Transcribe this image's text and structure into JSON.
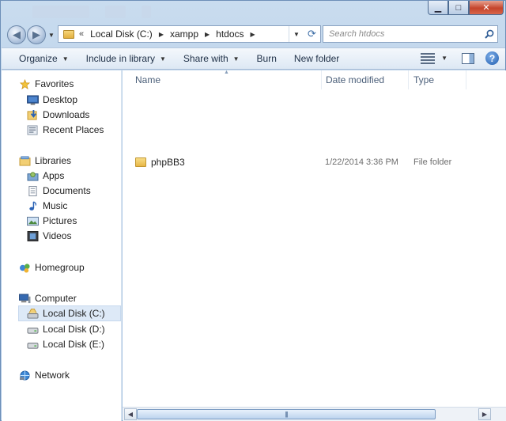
{
  "window": {
    "minimize": "▁",
    "maximize": "□",
    "close": "✕"
  },
  "address": {
    "overflow": "«",
    "crumbs": [
      "Local Disk (C:)",
      "xampp",
      "htdocs"
    ]
  },
  "search": {
    "placeholder": "Search htdocs"
  },
  "toolbar": {
    "organize": "Organize",
    "include_in_library": "Include in library",
    "share_with": "Share with",
    "burn": "Burn",
    "new_folder": "New folder"
  },
  "sidebar": {
    "favorites": "Favorites",
    "desktop": "Desktop",
    "downloads": "Downloads",
    "recent_places": "Recent Places",
    "libraries": "Libraries",
    "apps": "Apps",
    "documents": "Documents",
    "music": "Music",
    "pictures": "Pictures",
    "videos": "Videos",
    "homegroup": "Homegroup",
    "computer": "Computer",
    "local_disk_c": "Local Disk (C:)",
    "local_disk_d": "Local Disk (D:)",
    "local_disk_e": "Local Disk (E:)",
    "network": "Network"
  },
  "columns": {
    "name": "Name",
    "date_modified": "Date modified",
    "type": "Type"
  },
  "files": [
    {
      "name": "phpBB3",
      "date": "1/22/2014 3:36 PM",
      "type": "File folder"
    }
  ],
  "scrollbar": {
    "grip": "|||"
  },
  "colors": {
    "accent": "#3d6da6",
    "selected": "#dde9f7"
  }
}
